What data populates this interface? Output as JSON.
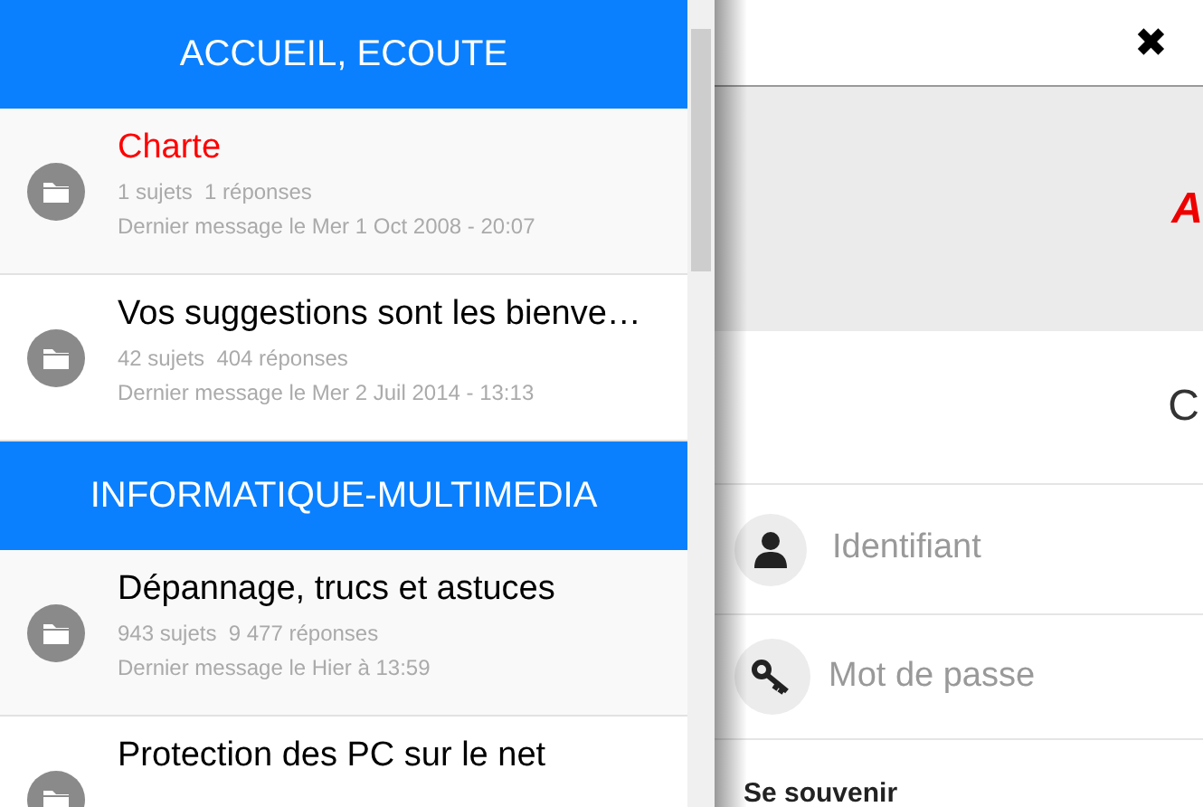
{
  "sidebar": {
    "sections": [
      {
        "title": "ACCUEIL, ECOUTE",
        "forums": [
          {
            "title": "Charte",
            "color": "#ff0000",
            "stats": "1 sujets  1 réponses",
            "last": "Dernier message le Mer 1 Oct 2008 - 20:07"
          },
          {
            "title": "Vos suggestions sont les bienve…",
            "color": "#000000",
            "stats": "42 sujets  404 réponses",
            "last": "Dernier message le Mer 2 Juil 2014 - 13:13"
          }
        ]
      },
      {
        "title": "INFORMATIQUE-MULTIMEDIA",
        "forums": [
          {
            "title": "Dépannage, trucs et astuces",
            "color": "#000000",
            "stats": "943 sujets  9 477 réponses",
            "last": "Dernier message le Hier à 13:59"
          },
          {
            "title": "Protection des PC sur le net",
            "color": "#000000"
          }
        ]
      }
    ]
  },
  "main": {
    "close": "✖",
    "logo": "A",
    "heading": "C",
    "username": {
      "placeholder": "Identifiant"
    },
    "password": {
      "placeholder": "Mot de passe"
    },
    "remember": "Se souvenir"
  }
}
